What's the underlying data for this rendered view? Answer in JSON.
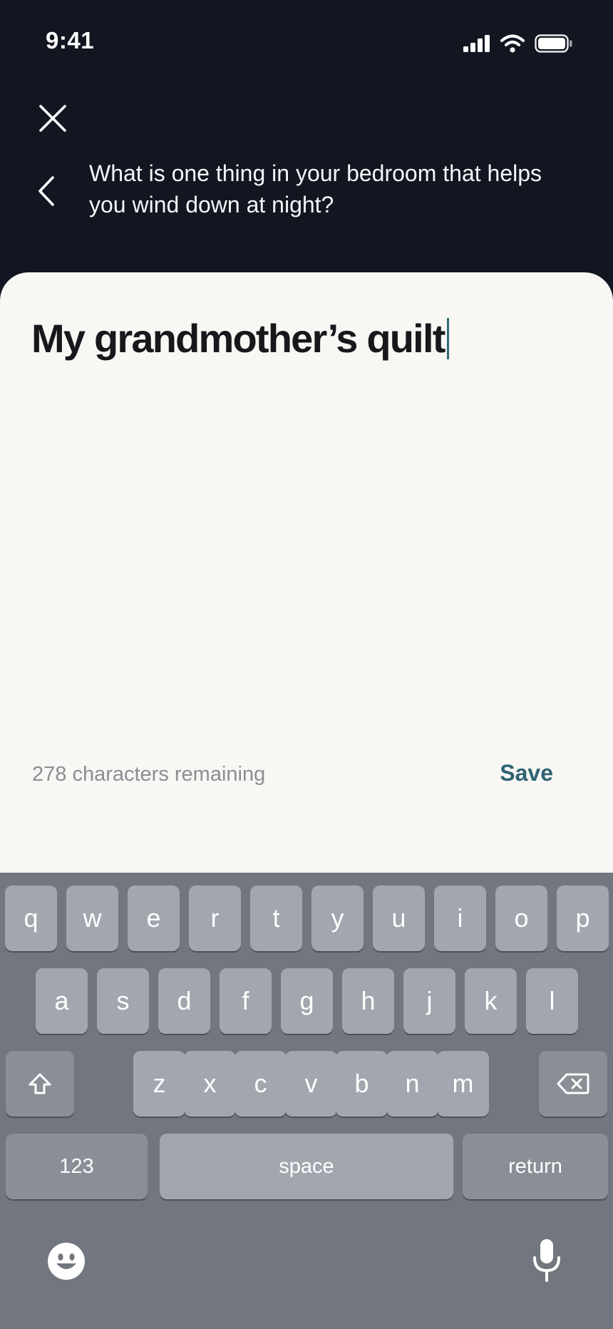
{
  "status_bar": {
    "time": "9:41"
  },
  "header": {
    "question": "What is one thing in your bedroom that helps you wind down at night?"
  },
  "editor": {
    "answer_text": "My grandmother’s quilt",
    "counter_text": "278 characters remaining",
    "save_label": "Save"
  },
  "keyboard": {
    "row1": [
      "q",
      "w",
      "e",
      "r",
      "t",
      "y",
      "u",
      "i",
      "o",
      "p"
    ],
    "row2": [
      "a",
      "s",
      "d",
      "f",
      "g",
      "h",
      "j",
      "k",
      "l"
    ],
    "row3": [
      "z",
      "x",
      "c",
      "v",
      "b",
      "n",
      "m"
    ],
    "numbers_label": "123",
    "space_label": "space",
    "return_label": "return"
  },
  "colors": {
    "header_bg": "#111620",
    "sheet_bg": "#f8f7f4",
    "accent": "#2f6373",
    "keyboard_bg": "#72767f"
  },
  "icons": {
    "close": "close-icon",
    "back": "chevron-left-icon",
    "shift": "shift-icon",
    "delete": "backspace-icon",
    "emoji": "emoji-icon",
    "mic": "microphone-icon"
  }
}
